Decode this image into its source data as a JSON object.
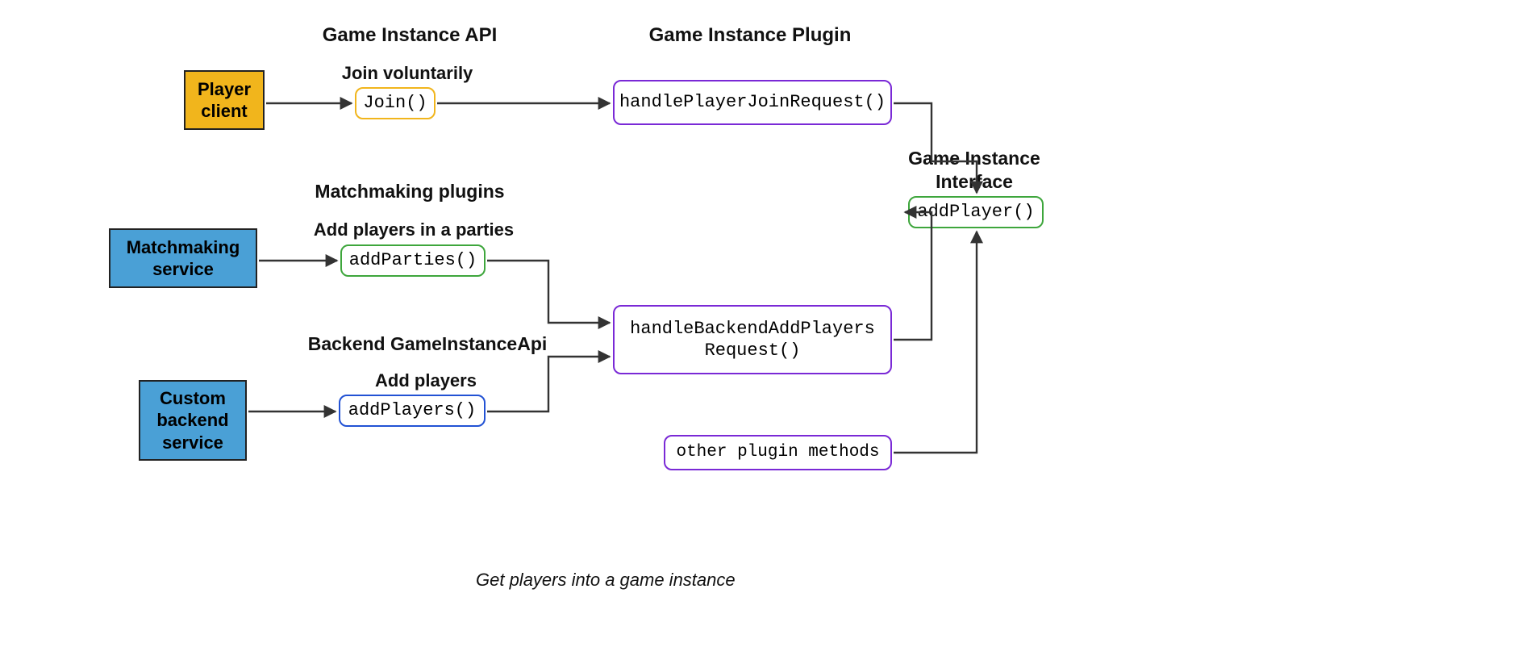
{
  "headings": {
    "game_instance_api": "Game Instance API",
    "game_instance_plugin": "Game Instance Plugin",
    "game_instance_interface": "Game Instance Interface",
    "matchmaking_plugins": "Matchmaking plugins",
    "backend_game_instance_api": "Backend GameInstanceApi"
  },
  "subheadings": {
    "join_voluntarily": "Join voluntarily",
    "add_players_in_parties": "Add players in a parties",
    "add_players": "Add players"
  },
  "sources": {
    "player_client": {
      "line1": "Player",
      "line2": "client"
    },
    "matchmaking_service": {
      "line1": "Matchmaking",
      "line2": "service"
    },
    "custom_backend_service": {
      "line1": "Custom",
      "line2": "backend",
      "line3": "service"
    }
  },
  "api_methods": {
    "join": "Join()",
    "add_parties": "addParties()",
    "add_players": "addPlayers()"
  },
  "plugin_methods": {
    "handle_player_join_request": "handlePlayerJoinRequest()",
    "handle_backend_add_players_line1": "handleBackendAddPlayers",
    "handle_backend_add_players_line2": "Request()",
    "other_plugin_methods": "other plugin methods"
  },
  "interface_methods": {
    "add_player": "addPlayer()"
  },
  "caption": "Get players into a game instance",
  "colors": {
    "yellow": "#f1b51c",
    "blue": "#4aa0d6",
    "purple": "#7a29d6",
    "green": "#3ea63c",
    "blue_dark": "#2252d4",
    "edge": "#333333"
  }
}
